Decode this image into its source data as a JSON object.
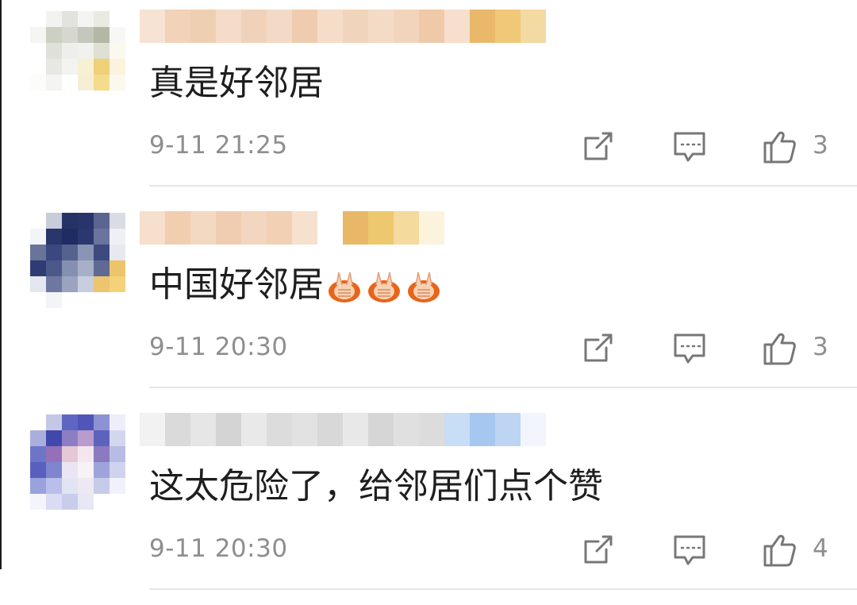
{
  "comments": [
    {
      "text": "真是好邻居",
      "time": "9-11 21:25",
      "likes": "3",
      "emoji_count": 0,
      "avatar_icon": "blurred-avatar-icon",
      "username_colors": [
        "#f6e3d4",
        "#f2d2b8",
        "#efcfb2",
        "#f4dcc8",
        "#f0d2ba",
        "#f3dac6",
        "#efccb0",
        "#f5ddc9",
        "#f1d4bc",
        "#f4dbc6",
        "#f2d4bc",
        "#efc9a8",
        "#f6dfcd",
        "#e9b86a",
        "#f0c878",
        "#f3d9a2"
      ],
      "avatar_colors": [
        "#ffffff",
        "#f2f2f0",
        "#e3e3dd",
        "#f4f4f2",
        "#e9ebe2",
        "#ffffff",
        "#f5f5f3",
        "#cbd0c2",
        "#d6d8cf",
        "#c4c7bc",
        "#b3b8a4",
        "#f7f7f5",
        "#ffffff",
        "#e0e0da",
        "#eeeeea",
        "#f1f1ed",
        "#dde0d3",
        "#fbf8ee",
        "#ffffff",
        "#e7e7e3",
        "#f3f3f0",
        "#f7f1d4",
        "#efd17a",
        "#fbf3dc",
        "#fcfcfa",
        "#f4f4f2",
        "#ffffff",
        "#f6efd6",
        "#f3dc8c",
        "#fbf8ee",
        "#ffffff",
        "#ffffff",
        "#ffffff",
        "#ffffff",
        "#ffffff",
        "#ffffff"
      ]
    },
    {
      "text": "中国好邻居",
      "time": "9-11 20:30",
      "likes": "3",
      "emoji_count": 3,
      "avatar_icon": "blurred-avatar-icon",
      "username_colors": [
        "#f6dfcc",
        "#f1ceb0",
        "#f4d9c2",
        "#f0cdb0",
        "#f3d6c0",
        "#f1d0b4",
        "#f6e0ce",
        "#ffffff",
        "#e9b768",
        "#eec86f",
        "#f4da9c",
        "#fbf3dc"
      ],
      "avatar_colors": [
        "#ffffff",
        "#c9cdd8",
        "#253266",
        "#28356a",
        "#5a6590",
        "#d9dce5",
        "#f3f4f7",
        "#28366c",
        "#1f2c62",
        "#2b3870",
        "#6a749c",
        "#eef0f4",
        "#6a7398",
        "#3b4880",
        "#54628e",
        "#8a94b4",
        "#3d4a80",
        "#e6e9ef",
        "#2f3c74",
        "#4a588a",
        "#8590b0",
        "#a8b0c8",
        "#5f6a94",
        "#ecc46a",
        "#e4e7ef",
        "#6d77a0",
        "#9aa3bf",
        "#c8cede",
        "#ebc56f",
        "#f3d27a",
        "#ffffff",
        "#f3f4f7",
        "#ffffff",
        "#ffffff",
        "#ffffff",
        "#ffffff"
      ]
    },
    {
      "text": "这太危险了，给邻居们点个赞",
      "time": "9-11 20:30",
      "likes": "4",
      "emoji_count": 0,
      "avatar_icon": "blurred-avatar-icon",
      "username_colors": [
        "#f2f2f2",
        "#dadada",
        "#e6e6e6",
        "#d4d4d4",
        "#e9e9e9",
        "#dcdcdc",
        "#e2e2e2",
        "#d8d8d8",
        "#e8e8e8",
        "#d6d6d6",
        "#e0e0e0",
        "#dcdcdc",
        "#c8ddf6",
        "#a6c8f0",
        "#bdd5f3",
        "#f2f6fc"
      ],
      "avatar_colors": [
        "#ffffff",
        "#c4c8e6",
        "#5f66c2",
        "#4f56b8",
        "#8c92d4",
        "#eceefa",
        "#a9aedd",
        "#4148ac",
        "#8d7ec4",
        "#b79ccc",
        "#5d63bc",
        "#d4d6ee",
        "#6e74c6",
        "#9470b8",
        "#e4c8d8",
        "#f3e6ef",
        "#8b7ac0",
        "#b8bce4",
        "#5860be",
        "#7f86cf",
        "#ebe4f2",
        "#f7f2f6",
        "#9ea4da",
        "#d0d3ee",
        "#9aa2dc",
        "#b9bfe8",
        "#e2e4f4",
        "#ede8f3",
        "#c7cbea",
        "#f0f1fa",
        "#f4f5fb",
        "#d9dcf2",
        "#c9cdeb",
        "#e6e8f6",
        "#ffffff",
        "#ffffff"
      ]
    }
  ],
  "colors": {
    "text": "#1e1e1e",
    "meta": "#8e8e8e",
    "divider": "#e6e6e6",
    "emoji_orange": "#e8641a"
  },
  "icons": {
    "forward": "share-icon",
    "reply": "comment-icon",
    "like": "thumbs-up-icon"
  }
}
